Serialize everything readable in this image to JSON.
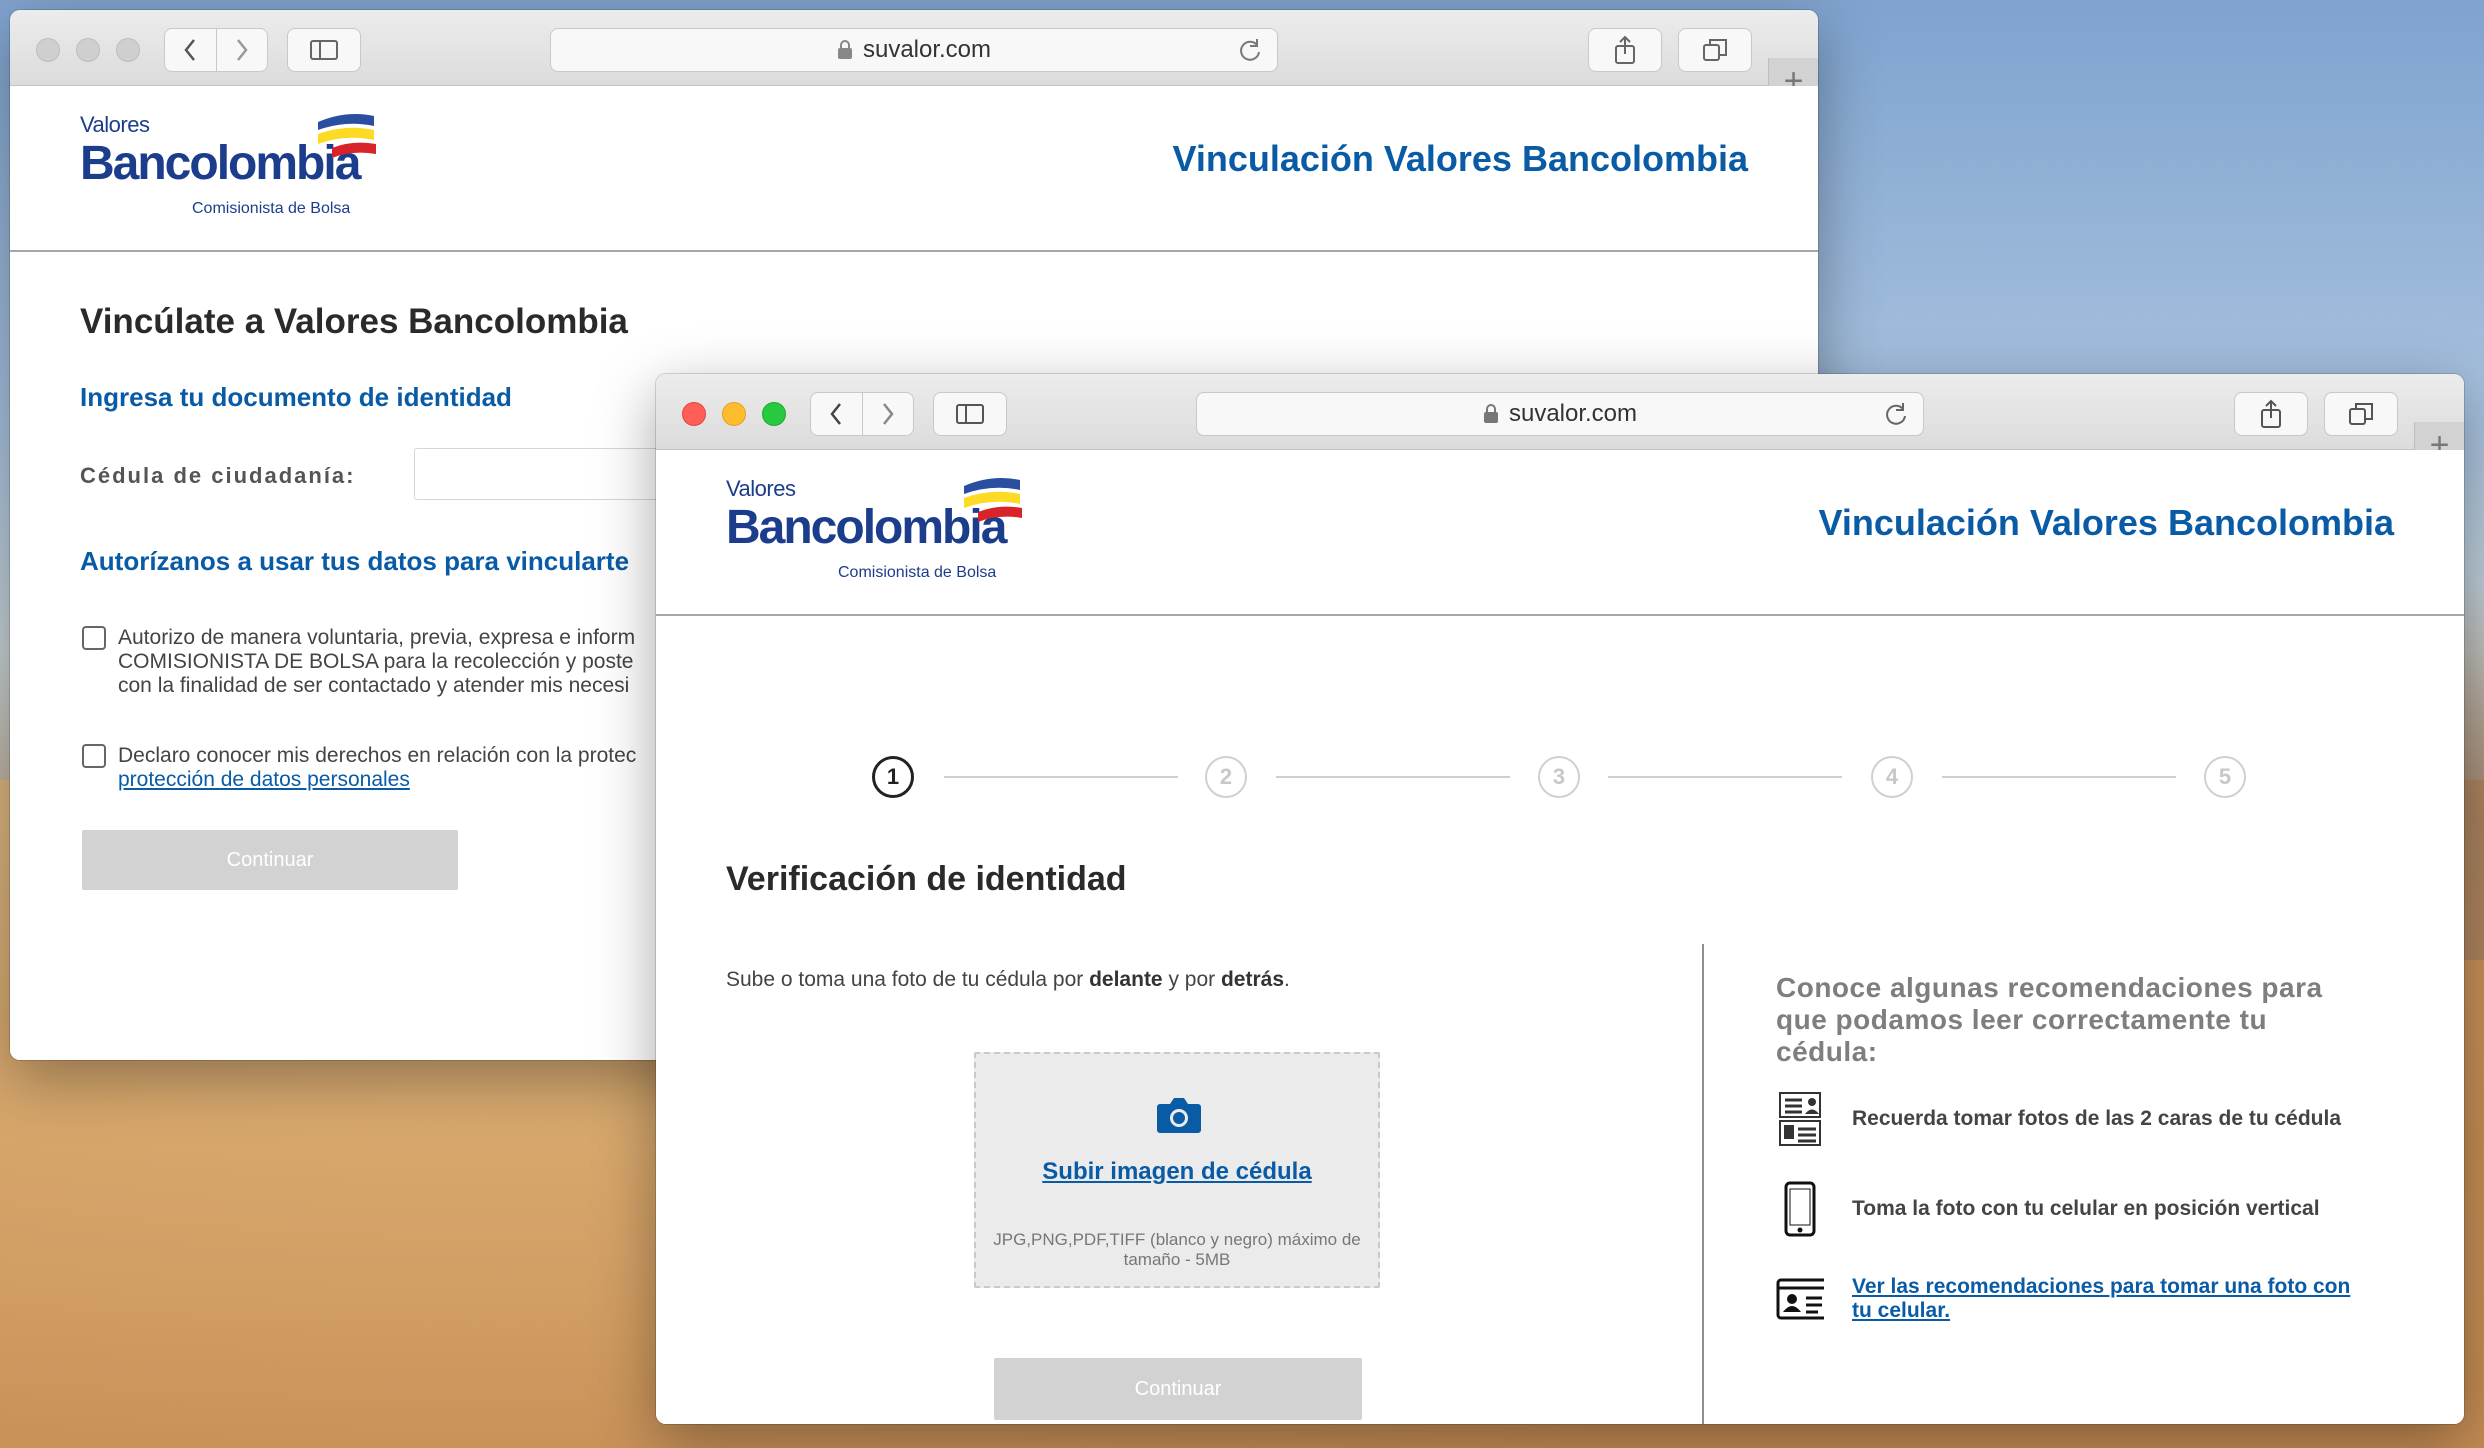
{
  "back_window": {
    "url": "suvalor.com",
    "logo": {
      "top": "Valores",
      "main": "Bancolombia",
      "sub": "Comisionista de Bolsa"
    },
    "header_title": "Vinculación Valores Bancolombia",
    "heading": "Vincúlate a Valores Bancolombia",
    "id_section_title": "Ingresa tu documento de identidad",
    "id_label": "Cédula de ciudadanía:",
    "id_value": "",
    "consent_title": "Autorízanos a usar tus datos para vincularte",
    "consent_1_lines": [
      "Autorizo de manera voluntaria, previa, expresa e inform",
      "COMISIONISTA DE BOLSA para la recolección y poste",
      "con la finalidad de ser contactado y atender mis necesi"
    ],
    "consent_2_line": "Declaro conocer mis derechos en relación con la protec",
    "consent_2_link": "protección de datos personales",
    "continue_label": "Continuar"
  },
  "front_window": {
    "url": "suvalor.com",
    "logo": {
      "top": "Valores",
      "main": "Bancolombia",
      "sub": "Comisionista de Bolsa"
    },
    "header_title": "Vinculación Valores Bancolombia",
    "steps": [
      "1",
      "2",
      "3",
      "4",
      "5"
    ],
    "active_step": 1,
    "heading": "Verificación de identidad",
    "intro": {
      "pre": "Sube o toma una foto de tu cédula por ",
      "b1": "delante",
      "mid": " y por ",
      "b2": "detrás",
      "post": "."
    },
    "upload": {
      "link": "Subir imagen de cédula",
      "hint": "JPG,PNG,PDF,TIFF (blanco y negro) máximo de tamaño - 5MB",
      "icon": "camera-icon"
    },
    "continue_label": "Continuar",
    "recommendations": {
      "title": "Conoce algunas recomendaciones para que podamos leer correctamente tu cédula:",
      "items": [
        {
          "icon": "id-card-icon",
          "text": "Recuerda tomar fotos de las 2 caras de tu cédula"
        },
        {
          "icon": "phone-icon",
          "text": "Toma la foto con tu celular en posición vertical"
        },
        {
          "icon": "photo-id-icon",
          "text": "Ver las recomendaciones para tomar una foto con tu celular."
        }
      ]
    }
  },
  "colors": {
    "brand_blue": "#0a5ba6",
    "logo_blue": "#1c3c8c",
    "flag_yellow": "#fdda24",
    "flag_blue": "#2a4fa0",
    "flag_red": "#d8232a"
  }
}
